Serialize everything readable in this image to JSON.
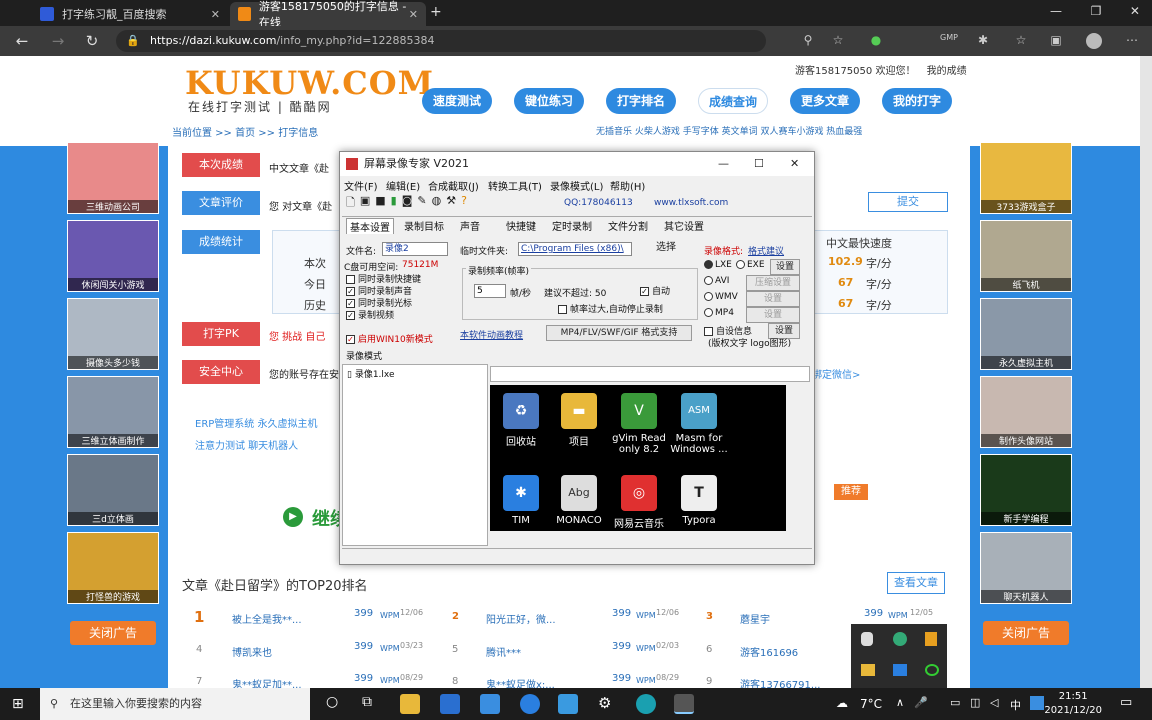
{
  "browser": {
    "tabs": [
      {
        "label": "打字练习靓_百度搜索",
        "favicon_color": "#2f5bd8"
      },
      {
        "label": "游客158175050的打字信息 - 在线",
        "favicon_color": "#f08a16"
      }
    ],
    "url_host": "https://dazi.kukuw.com",
    "url_path": "/info_my.php?id=122885384"
  },
  "site": {
    "logo": "KUKUW.COM",
    "slogan": "在线打字测试 | 酷酷网",
    "nav": [
      "速度测试",
      "键位练习",
      "打字排名",
      "成绩查询",
      "更多文章",
      "我的打字"
    ],
    "user_greeting": "游客158175050 欢迎您！",
    "my_scores": "我的成绩",
    "breadcrumb": "当前位置 >> 首页 >> 打字信息",
    "top_links": "无插音乐  火柴人游戏  手写字体  英文单词  双人赛车小游戏  热血最强"
  },
  "left_ads": [
    "三维动画公司",
    "休闲闯关小游戏",
    "摄像头多少钱",
    "三维立体画制作",
    "三d立体画",
    "打怪兽的游戏"
  ],
  "right_ads": [
    "3733游戏盒子",
    "纸飞机",
    "永久虚拟主机",
    "制作头像网站",
    "新手学编程",
    "聊天机器人"
  ],
  "close_ad": "关闭广告",
  "sections": {
    "current": "本次成绩",
    "current_text": "中文文章《赴",
    "review": "文章评价",
    "review_text": "您 对文章《赴",
    "submit": "提交",
    "stats": "成绩统计",
    "stat_header": "中文最快速度",
    "stat_rows": [
      {
        "label": "本次",
        "value": "102.9",
        "unit": "字/分"
      },
      {
        "label": "今日",
        "value": "67",
        "unit": "字/分"
      },
      {
        "label": "历史",
        "value": "67",
        "unit": "字/分"
      }
    ],
    "pk": "打字PK",
    "pk_text": "您 挑战 自己",
    "security": "安全中心",
    "security_text": "您的账号存在安",
    "wechat": "绑定微信>",
    "links1": "ERP管理系统  永久虚拟主机",
    "links2": "注意力测试  聊天机器人",
    "continue": "继续",
    "recommend": "推荐",
    "top20_title": "文章《赴日留学》的TOP20排名",
    "view_article": "查看文章"
  },
  "rankings": [
    {
      "rank": "1",
      "name": "被上全是我**...",
      "score": "399",
      "date": "12/06"
    },
    {
      "rank": "2",
      "name": "阳光正好，微...",
      "score": "399",
      "date": "12/06"
    },
    {
      "rank": "3",
      "name": "蘑星宇",
      "score": "399",
      "date": "12/05"
    },
    {
      "rank": "4",
      "name": "博凯来也",
      "score": "399",
      "date": "03/23"
    },
    {
      "rank": "5",
      "name": "腾讯***",
      "score": "399",
      "date": "02/03"
    },
    {
      "rank": "6",
      "name": "游客161696",
      "score": "",
      "date": ""
    },
    {
      "rank": "7",
      "name": "鬼**蚁足加**...",
      "score": "399",
      "date": "08/29"
    },
    {
      "rank": "8",
      "name": "鬼**蚁足做x:...",
      "score": "399",
      "date": "08/29"
    },
    {
      "rank": "9",
      "name": "游客13766791...",
      "score": "",
      "date": ""
    }
  ],
  "rank_unit": "WPM",
  "dialog": {
    "title": "屏幕录像专家 V2021",
    "menus": [
      "文件(F)",
      "编辑(E)",
      "合成截取(J)",
      "转换工具(T)",
      "录像模式(L)",
      "帮助(H)"
    ],
    "qq": "QQ:178046113",
    "site": "www.tlxsoft.com",
    "tabs": [
      "基本设置",
      "录制目标",
      "声音",
      "快捷键",
      "定时录制",
      "文件分割",
      "其它设置"
    ],
    "filename_label": "文件名:",
    "filename": "录像2",
    "disk_label": "C盘可用空间:",
    "disk_value": "75121M",
    "checks": [
      "同时录制快捷键",
      "同时录制声音",
      "同时录制光标",
      "录制视频"
    ],
    "temp_label": "临时文件夹:",
    "temp_path": "C:\\Program Files (x86)\\",
    "choose": "选择",
    "freq_label": "录制频率(帧率)",
    "freq_value": "5",
    "freq_unit": "帧/秒",
    "suggest": "建议不超过: 50",
    "auto": "自动",
    "auto_stop": "帧率过大,自动停止录制",
    "format_label": "录像格式:",
    "format_suggest": "格式建议",
    "formats": [
      "LXE",
      "EXE",
      "AVI",
      "WMV",
      "MP4"
    ],
    "set": "设置",
    "compress_set": "压缩设置",
    "custom_info": "自设信息",
    "copyright": "(版权文字 logo图形)",
    "tutorial": "本软件动画教程",
    "format_support": "MP4/FLV/SWF/GIF 格式支持",
    "win10": "启用WIN10新模式",
    "record_mode": "录像模式",
    "file_item": "录像1.lxe"
  },
  "desktop_icons": [
    {
      "label": "回收站",
      "color": "#4a78c0"
    },
    {
      "label": "项目",
      "color": "#e8b83a"
    },
    {
      "label": "gVim Read only 8.2",
      "color": "#3a9a3a"
    },
    {
      "label": "Masm for Windows ...",
      "color": "#4aa0c8"
    },
    {
      "label": "TIM",
      "color": "#2a7fe0"
    },
    {
      "label": "MONACO",
      "color": "#ddd"
    },
    {
      "label": "网易云音乐",
      "color": "#e03030"
    },
    {
      "label": "Typora",
      "color": "#eee"
    }
  ],
  "taskbar": {
    "search_placeholder": "在这里输入你要搜索的内容",
    "weather": "7°C",
    "ime": "中",
    "time": "21:51",
    "date": "2021/12/20"
  }
}
